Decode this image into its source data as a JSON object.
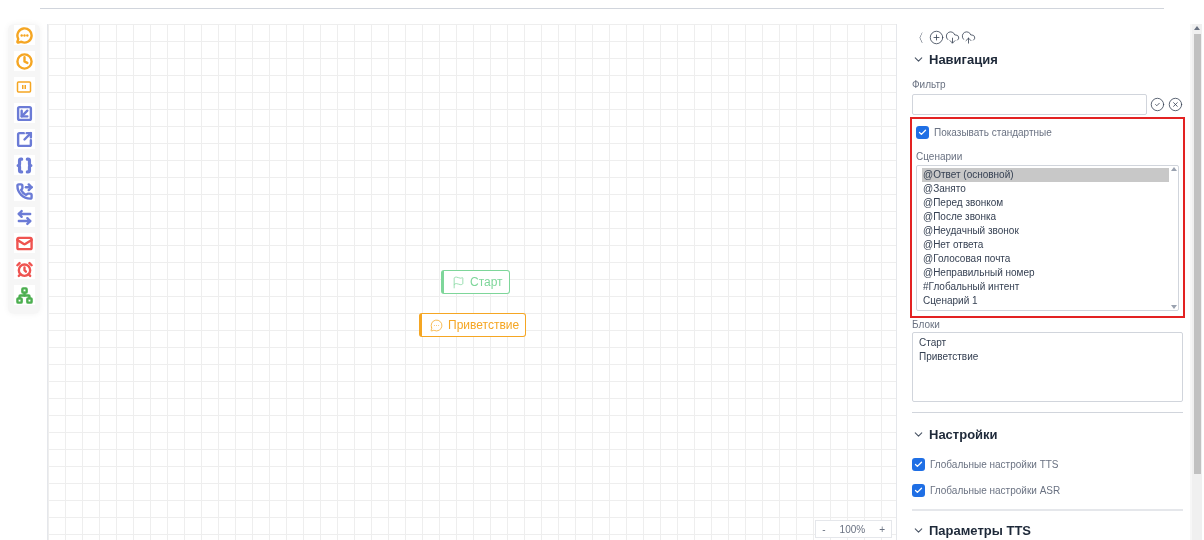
{
  "toolbar": [
    {
      "kind": "chat",
      "color": "#f5a623"
    },
    {
      "kind": "clock",
      "color": "#f5a623"
    },
    {
      "kind": "pause",
      "color": "#f5a623"
    },
    {
      "kind": "import",
      "color": "#6b7bd6"
    },
    {
      "kind": "export",
      "color": "#6b7bd6"
    },
    {
      "kind": "braces",
      "color": "#6b7bd6"
    },
    {
      "kind": "phone",
      "color": "#6b7bd6"
    },
    {
      "kind": "swap",
      "color": "#6b7bd6"
    },
    {
      "kind": "mail",
      "color": "#ef5350"
    },
    {
      "kind": "alarm",
      "color": "#ef5350"
    },
    {
      "kind": "tree",
      "color": "#4caf50"
    }
  ],
  "canvas": {
    "nodes": [
      {
        "kind": "start",
        "label": "Старт",
        "color": "#7ed69a"
      },
      {
        "kind": "message",
        "label": "Приветствие",
        "color": "#f5a623"
      }
    ],
    "zoom": {
      "minus": "-",
      "value": "100%",
      "plus": "+"
    }
  },
  "panel": {
    "back": "〈",
    "navigation": {
      "title": "Навигация",
      "filter_label": "Фильтр",
      "show_standard": {
        "label": "Показывать стандартные",
        "checked": true
      },
      "scenarios_label": "Сценарии",
      "scenarios": [
        {
          "label": "@Ответ (основной)",
          "selected": true
        },
        {
          "label": "@Занято",
          "selected": false
        },
        {
          "label": "@Перед звонком",
          "selected": false
        },
        {
          "label": "@После звонка",
          "selected": false
        },
        {
          "label": "@Неудачный звонок",
          "selected": false
        },
        {
          "label": "@Нет ответа",
          "selected": false
        },
        {
          "label": "@Голосовая почта",
          "selected": false
        },
        {
          "label": "@Неправильный номер",
          "selected": false
        },
        {
          "label": "#Глобальный интент",
          "selected": false
        },
        {
          "label": "Сценарий 1",
          "selected": false
        }
      ],
      "blocks_label": "Блоки",
      "blocks": [
        "Старт",
        "Приветствие"
      ]
    },
    "settings": {
      "title": "Настройки",
      "options": [
        {
          "label": "Глобальные настройки TTS",
          "checked": true
        },
        {
          "label": "Глобальные настройки ASR",
          "checked": true
        }
      ]
    },
    "tts": {
      "title": "Параметры TTS"
    }
  }
}
